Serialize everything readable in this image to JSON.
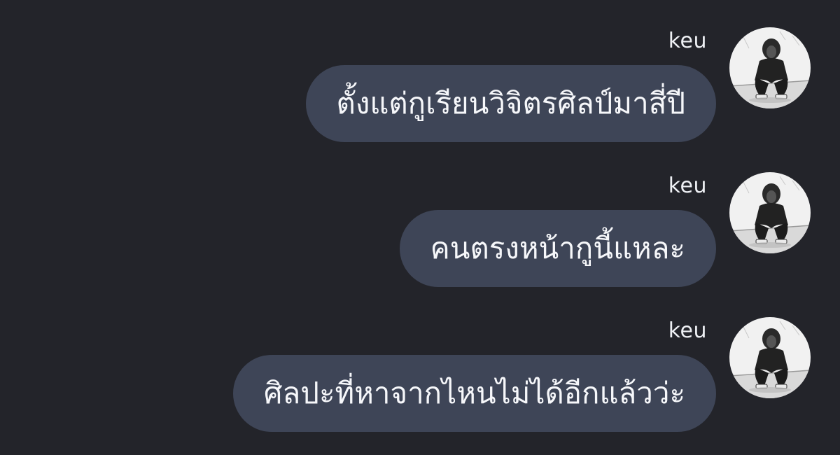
{
  "messages": [
    {
      "sender": "keu",
      "text": "ตั้งแต่กูเรียนวิจิตรศิลป์มาสี่ปี",
      "avatar_icon": "profile-photo-hooded-figure"
    },
    {
      "sender": "keu",
      "text": "คนตรงหน้ากูนี้แหละ",
      "avatar_icon": "profile-photo-hooded-figure"
    },
    {
      "sender": "keu",
      "text": "ศิลปะที่หาจากไหนไม่ได้อีกแล้วว่ะ",
      "avatar_icon": "profile-photo-hooded-figure"
    }
  ],
  "colors": {
    "background": "#23242a",
    "bubble": "#3e4557",
    "text": "#f6f7fa"
  }
}
